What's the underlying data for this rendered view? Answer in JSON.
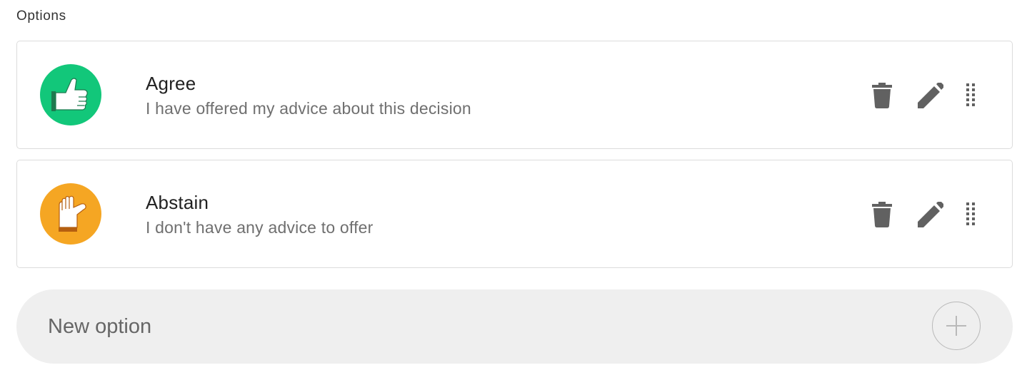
{
  "section_label": "Options",
  "options": [
    {
      "title": "Agree",
      "description": "I have offered my advice about this decision",
      "icon": "thumbs-up-icon",
      "color": "#12c77a"
    },
    {
      "title": "Abstain",
      "description": "I don't have any advice to offer",
      "icon": "thumb-sideways-icon",
      "color": "#f5a623"
    }
  ],
  "new_option": {
    "placeholder": "New option",
    "add_icon": "plus-icon"
  },
  "action_icons": [
    "trash-icon",
    "pencil-icon",
    "drag-handle-icon"
  ]
}
